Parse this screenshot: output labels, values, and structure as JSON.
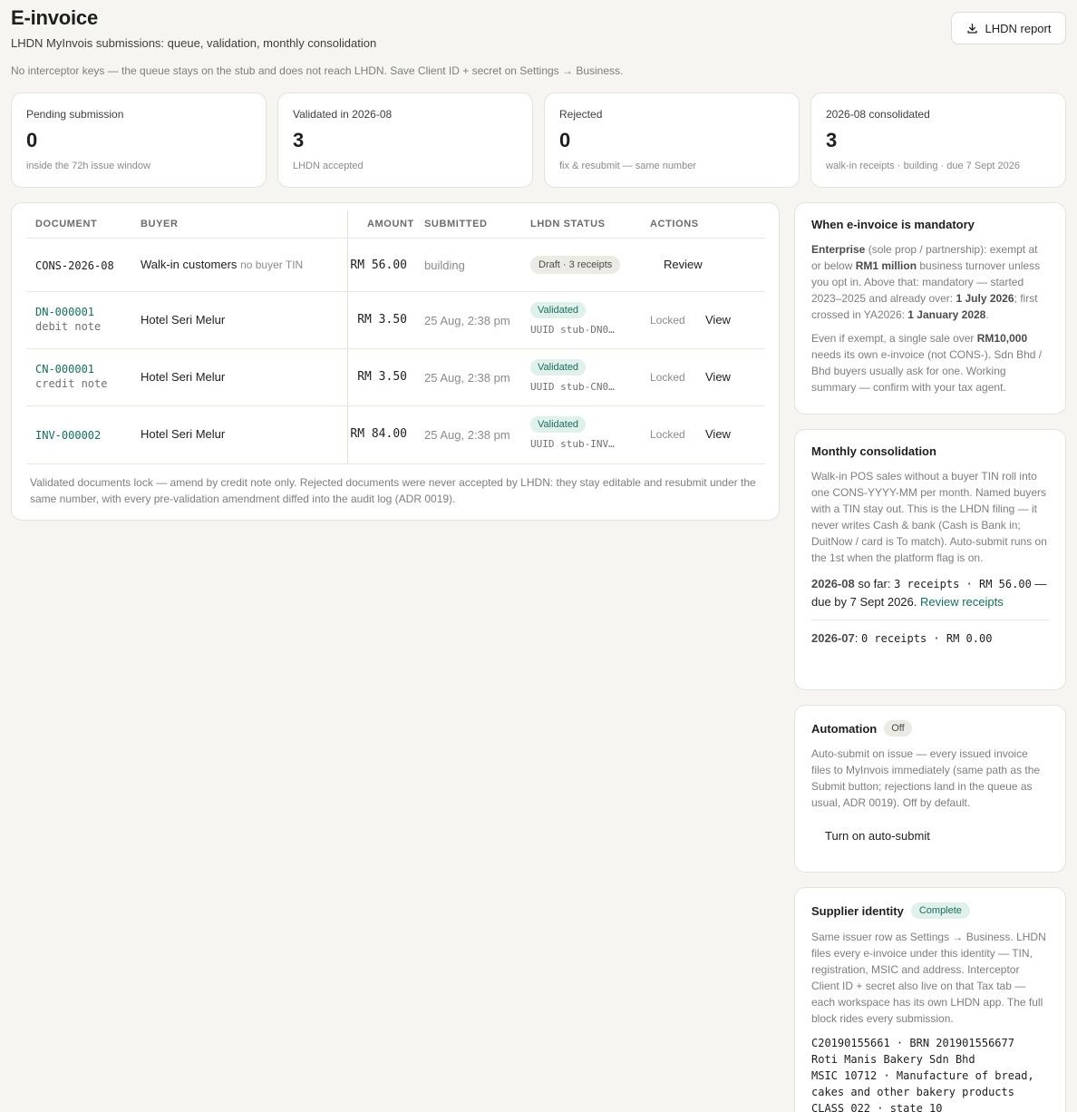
{
  "header": {
    "title": "E-invoice",
    "subtitle": "LHDN MyInvois submissions: queue, validation, monthly consolidation",
    "notice": "No interceptor keys — the queue stays on the stub and does not reach LHDN. Save Client ID + secret on Settings → Business.",
    "report_label": "LHDN report"
  },
  "stats": [
    {
      "label": "Pending submission",
      "value": "0",
      "sub": "inside the 72h issue window"
    },
    {
      "label": "Validated in 2026-08",
      "value": "3",
      "sub": "LHDN accepted"
    },
    {
      "label": "Rejected",
      "value": "0",
      "sub": "fix & resubmit — same number"
    },
    {
      "label": "2026-08 consolidated",
      "value": "3",
      "sub": "walk-in receipts · building · due 7 Sept 2026"
    }
  ],
  "table": {
    "columns": {
      "document": "DOCUMENT",
      "buyer": "BUYER",
      "amount": "AMOUNT",
      "submitted": "SUBMITTED",
      "status": "LHDN STATUS",
      "actions": "ACTIONS"
    },
    "rows": [
      {
        "doc": "CONS-2026-08",
        "kind": "",
        "buyer": "Walk-in customers",
        "buyer_note": "no buyer TIN",
        "amount": "RM 56.00",
        "submitted": "building",
        "status": "Draft · 3 receipts",
        "uuid": "",
        "lock": "",
        "action": "Review"
      },
      {
        "doc": "DN-000001",
        "kind": "debit note",
        "buyer": "Hotel Seri Melur",
        "buyer_note": "",
        "amount": "RM 3.50",
        "submitted": "25 Aug, 2:38 pm",
        "status": "Validated",
        "uuid": "UUID stub-DN0…",
        "lock": "Locked",
        "action": "View"
      },
      {
        "doc": "CN-000001",
        "kind": "credit note",
        "buyer": "Hotel Seri Melur",
        "buyer_note": "",
        "amount": "RM 3.50",
        "submitted": "25 Aug, 2:38 pm",
        "status": "Validated",
        "uuid": "UUID stub-CN0…",
        "lock": "Locked",
        "action": "View"
      },
      {
        "doc": "INV-000002",
        "kind": "",
        "buyer": "Hotel Seri Melur",
        "buyer_note": "",
        "amount": "RM 84.00",
        "submitted": "25 Aug, 2:38 pm",
        "status": "Validated",
        "uuid": "UUID stub-INV…",
        "lock": "Locked",
        "action": "View"
      }
    ],
    "footnote": "Validated documents lock — amend by credit note only. Rejected documents were never accepted by LHDN: they stay editable and resubmit under the same number, with every pre-validation amendment diffed into the audit log (ADR 0019)."
  },
  "mandatory": {
    "title": "When e-invoice is mandatory",
    "p1_a": "Enterprise",
    "p1_b": " (sole prop / partnership): exempt at or below ",
    "p1_c": "RM1 million",
    "p1_d": " business turnover unless you opt in. Above that: mandatory — started 2023–2025 and already over: ",
    "p1_e": "1 July 2026",
    "p1_f": "; first crossed in YA2026: ",
    "p1_g": "1 January 2028",
    "p1_h": ".",
    "p2_a": "Even if exempt, a single sale over ",
    "p2_b": "RM10,000",
    "p2_c": " needs its own e-invoice (not CONS-). Sdn Bhd / Bhd buyers usually ask for one. Working summary — confirm with your tax agent."
  },
  "consolidation": {
    "title": "Monthly consolidation",
    "desc": "Walk-in POS sales without a buyer TIN roll into one CONS-YYYY-MM per month. Named buyers with a TIN stay out. This is the LHDN filing — it never writes Cash & bank (Cash is Bank in; DuitNow / card is To match). Auto-submit runs on the 1st when the platform flag is on.",
    "cur_month": "2026-08",
    "cur_sofar": " so far: ",
    "cur_stats": "3 receipts · RM 56.00",
    "cur_due": " — due by 7 Sept 2026. ",
    "cur_link": "Review receipts",
    "prev_month": "2026-07",
    "prev_sep": ": ",
    "prev_stats": "0 receipts · RM 0.00"
  },
  "automation": {
    "title": "Automation",
    "status": "Off",
    "desc": "Auto-submit on issue — every issued invoice files to MyInvois immediately (same path as the Submit button; rejections land in the queue as usual, ADR 0019). Off by default.",
    "button": "Turn on auto-submit"
  },
  "supplier": {
    "title": "Supplier identity",
    "status": "Complete",
    "desc": "Same issuer row as Settings → Business. LHDN files every e-invoice under this identity — TIN, registration, MSIC and address. Interceptor Client ID + secret also live on that Tax tab — each workspace has its own LHDN app. The full block rides every submission.",
    "block": "C20190155661 · BRN 201901556677\nRoti Manis Bakery Sdn Bhd\nMSIC 10712 · Manufacture of bread, cakes and other bakery products\nCLASS 022 · state 10"
  }
}
